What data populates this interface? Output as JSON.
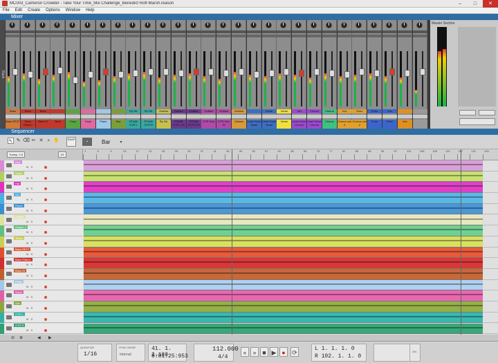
{
  "window": {
    "title": "MC003_Cameron Crowder - Take Your Time_Mix Challenge_Benedict Roff-Marsh.reason"
  },
  "menu": [
    "File",
    "Edit",
    "Create",
    "Options",
    "Window",
    "Help"
  ],
  "mixer": {
    "panel_label": "Mixer",
    "side_tab": "Rack",
    "strip_names": [
      "Bass",
      "Bass",
      "Bass",
      "",
      "",
      "",
      "",
      "",
      "Ry Gtr",
      "Ry Gtr",
      "Guitars",
      "Guitars",
      "Guitars",
      "Guitars",
      "Guitars",
      "Guitars",
      "",
      "Verse",
      "Verse",
      "Vox",
      "Chorus",
      "Chorus",
      "Vox",
      "Echo",
      "Echo",
      "Vox",
      "",
      ""
    ],
    "bottom_names": [
      "Bass REZT",
      "Bass Ribbon",
      "Bass DI",
      "Bass",
      "Keys",
      "Keys",
      "Piano",
      "Sax",
      "RT#4B GTR L",
      "RT#4B GTR R",
      "Ry Gtr",
      "RT#4B GTR L DI",
      "RT#4B GTR R DI",
      "GTR Solo",
      "GTR Solo DI",
      "Guitars",
      "Lead Vocal Verse",
      "Lead Vocal Verse",
      "Verse",
      "Lead Vocal Chorus",
      "Lead Vocal Chorus",
      "Chorus",
      "Chorus ooh 2",
      "Chorus ooh 2",
      "Echo",
      "Echo",
      "Vox",
      ""
    ],
    "colors": [
      "#d0793a",
      "#c0392b",
      "#c0392b",
      "#c0392b",
      "#5aa543",
      "#e0699f",
      "#9fc8e6",
      "#7a9e3a",
      "#3aa7a0",
      "#3aa7a0",
      "#c7c04c",
      "#6b3a8e",
      "#6b3a8e",
      "#b04aa8",
      "#b04aa8",
      "#d79a3a",
      "#3c6fc0",
      "#3c6fc0",
      "#f0e040",
      "#9b4ad0",
      "#9b4ad0",
      "#40c080",
      "#e0a030",
      "#e0a030",
      "#3b66c9",
      "#3b66c9",
      "#e09020",
      "#9a9a9a"
    ],
    "master_title": "Master Section"
  },
  "sequencer": {
    "panel_label": "Sequencer",
    "snap_label": "SNAP",
    "bar_value": "Bar",
    "track_header_buttons": [
      "Transp. 1/4",
      "1/4"
    ],
    "ruler": [
      "1",
      "5",
      "9",
      "13",
      "17",
      "21",
      "25",
      "29",
      "33",
      "37",
      "41",
      "45",
      "49",
      "53",
      "57",
      "61",
      "65",
      "69",
      "73",
      "77",
      "81",
      "85",
      "89",
      "93",
      "97",
      "101",
      "105",
      "109",
      "113",
      "117",
      "121",
      "125"
    ],
    "tracks": [
      {
        "name": "Kick",
        "color": "#d88ad8",
        "clip": "#d8a0d8"
      },
      {
        "name": "Snare",
        "color": "#b0cf60",
        "clip": "#c8e070"
      },
      {
        "name": "Hat",
        "color": "#e030c0",
        "clip": "#e040c8"
      },
      {
        "name": "OH",
        "color": "#4ab0e0",
        "clip": "#5ab8e8"
      },
      {
        "name": "Room",
        "color": "#3a8fd0",
        "clip": "#4a98d8"
      },
      {
        "name": "Shaker",
        "color": "#e0e0a0",
        "clip": "#e8e8c0"
      },
      {
        "name": "Shaker 2",
        "color": "#60c080",
        "clip": "#70d090"
      },
      {
        "name": "Timbo",
        "color": "#c8d050",
        "clip": "#d8e060"
      },
      {
        "name": "Bass REZT",
        "color": "#e05030",
        "clip": "#e85a3a"
      },
      {
        "name": "Bass Ribbon",
        "color": "#d03030",
        "clip": "#d83838"
      },
      {
        "name": "Bass DI",
        "color": "#c06030",
        "clip": "#c86838"
      },
      {
        "name": "Piano",
        "color": "#a0c8e8",
        "clip": "#b0d0f0"
      },
      {
        "name": "Vocal",
        "color": "#e060a8",
        "clip": "#e868b0"
      },
      {
        "name": "Sax",
        "color": "#8aa840",
        "clip": "#94b048"
      },
      {
        "name": "GTR L",
        "color": "#30b0a8",
        "clip": "#38b8b0"
      },
      {
        "name": "GTR R",
        "color": "#30a070",
        "clip": "#38a878"
      }
    ]
  },
  "transport": {
    "quantize_label": "QUANTIZE",
    "quantize_value": "1/16",
    "sync_label": "SYNC MODE",
    "sync_value": "Internal",
    "position": "41. 1. 2.188",
    "time": "0:01:25:953",
    "tempo": "112.000",
    "signature": "4/4",
    "loop_l": "L   1. 1. 1.   0",
    "loop_r": "R  102. 1. 1.   0",
    "on_label": "ON"
  }
}
